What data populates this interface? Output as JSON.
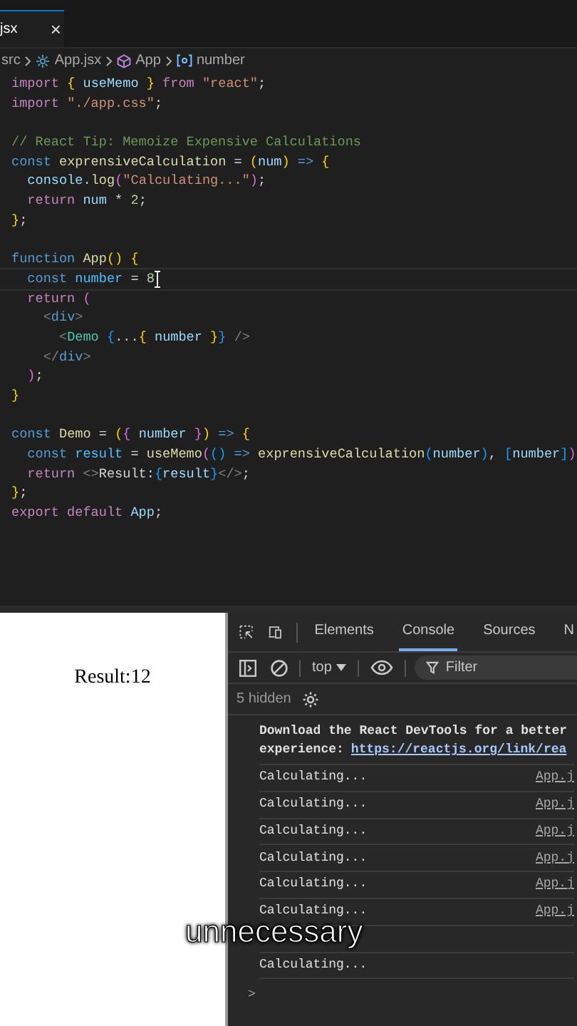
{
  "editor": {
    "tab": {
      "label": "jsx",
      "close": "×",
      "selected": true
    },
    "breadcrumb": [
      {
        "kind": "folder",
        "text": "src"
      },
      {
        "kind": "file",
        "text": "App.jsx"
      },
      {
        "kind": "component",
        "text": "App"
      },
      {
        "kind": "variable",
        "text": "number"
      }
    ],
    "lines": [
      {
        "kind": "code",
        "tokens": [
          {
            "kind": "kw",
            "text": "import "
          },
          {
            "kind": "b1",
            "text": "{"
          },
          {
            "kind": "var",
            "text": " useMemo "
          },
          {
            "kind": "b1",
            "text": "} "
          },
          {
            "kind": "kw",
            "text": "from "
          },
          {
            "kind": "str",
            "text": "\"react\""
          },
          {
            "kind": "p",
            "text": ";"
          }
        ]
      },
      {
        "kind": "code",
        "tokens": [
          {
            "kind": "kw",
            "text": "import "
          },
          {
            "kind": "str",
            "text": "\"./app.css\""
          },
          {
            "kind": "p",
            "text": ";"
          }
        ]
      },
      {
        "kind": "blank"
      },
      {
        "kind": "code",
        "tokens": [
          {
            "kind": "cmt",
            "text": "// React Tip: Memoize Expensive Calculations"
          }
        ]
      },
      {
        "kind": "code",
        "tokens": [
          {
            "kind": "decl",
            "text": "const "
          },
          {
            "kind": "fn",
            "text": "exprensiveCalculation"
          },
          {
            "kind": "p",
            "text": " = "
          },
          {
            "kind": "b1",
            "text": "("
          },
          {
            "kind": "var",
            "text": "num"
          },
          {
            "kind": "b1",
            "text": ") "
          },
          {
            "kind": "decl",
            "text": "=> "
          },
          {
            "kind": "b1",
            "text": "{"
          }
        ]
      },
      {
        "kind": "code",
        "tokens": [
          {
            "kind": "var",
            "text": "  console"
          },
          {
            "kind": "p",
            "text": "."
          },
          {
            "kind": "fn",
            "text": "log"
          },
          {
            "kind": "b2",
            "text": "("
          },
          {
            "kind": "str",
            "text": "\"Calculating...\""
          },
          {
            "kind": "b2",
            "text": ")"
          },
          {
            "kind": "p",
            "text": ";"
          }
        ]
      },
      {
        "kind": "code",
        "tokens": [
          {
            "kind": "kw",
            "text": "  return "
          },
          {
            "kind": "var",
            "text": "num"
          },
          {
            "kind": "p",
            "text": " * "
          },
          {
            "kind": "num",
            "text": "2"
          },
          {
            "kind": "p",
            "text": ";"
          }
        ]
      },
      {
        "kind": "code",
        "tokens": [
          {
            "kind": "b1",
            "text": "}"
          },
          {
            "kind": "p",
            "text": ";"
          }
        ]
      },
      {
        "kind": "blank"
      },
      {
        "kind": "code",
        "tokens": [
          {
            "kind": "decl",
            "text": "function "
          },
          {
            "kind": "fn",
            "text": "App"
          },
          {
            "kind": "b1",
            "text": "() {"
          }
        ]
      },
      {
        "kind": "code",
        "current": true,
        "tokens": [
          {
            "kind": "decl",
            "text": "  const "
          },
          {
            "kind": "cvar",
            "text": "number"
          },
          {
            "kind": "p",
            "text": " = "
          },
          {
            "kind": "num",
            "text": "8"
          }
        ]
      },
      {
        "kind": "code",
        "tokens": [
          {
            "kind": "kw",
            "text": "  return "
          },
          {
            "kind": "b2",
            "text": "("
          }
        ]
      },
      {
        "kind": "code",
        "tokens": [
          {
            "kind": "tagp",
            "text": "    <"
          },
          {
            "kind": "decl",
            "text": "div"
          },
          {
            "kind": "tagp",
            "text": ">"
          }
        ]
      },
      {
        "kind": "code",
        "tokens": [
          {
            "kind": "tagp",
            "text": "      <"
          },
          {
            "kind": "tag",
            "text": "Demo "
          },
          {
            "kind": "b3",
            "text": "{"
          },
          {
            "kind": "p",
            "text": "..."
          },
          {
            "kind": "b1",
            "text": "{"
          },
          {
            "kind": "var",
            "text": " number "
          },
          {
            "kind": "b1",
            "text": "}"
          },
          {
            "kind": "b3",
            "text": "} "
          },
          {
            "kind": "tagp",
            "text": "/>"
          }
        ]
      },
      {
        "kind": "code",
        "tokens": [
          {
            "kind": "tagp",
            "text": "    </"
          },
          {
            "kind": "decl",
            "text": "div"
          },
          {
            "kind": "tagp",
            "text": ">"
          }
        ]
      },
      {
        "kind": "code",
        "tokens": [
          {
            "kind": "b2",
            "text": "  )"
          },
          {
            "kind": "p",
            "text": ";"
          }
        ]
      },
      {
        "kind": "code",
        "tokens": [
          {
            "kind": "b1",
            "text": "}"
          }
        ]
      },
      {
        "kind": "blank"
      },
      {
        "kind": "code",
        "tokens": [
          {
            "kind": "decl",
            "text": "const "
          },
          {
            "kind": "fn",
            "text": "Demo"
          },
          {
            "kind": "p",
            "text": " = "
          },
          {
            "kind": "b1",
            "text": "("
          },
          {
            "kind": "b2",
            "text": "{"
          },
          {
            "kind": "var",
            "text": " number "
          },
          {
            "kind": "b2",
            "text": "}"
          },
          {
            "kind": "b1",
            "text": ") "
          },
          {
            "kind": "decl",
            "text": "=> "
          },
          {
            "kind": "b1",
            "text": "{"
          }
        ]
      },
      {
        "kind": "code",
        "tokens": [
          {
            "kind": "decl",
            "text": "  const "
          },
          {
            "kind": "cvar",
            "text": "result"
          },
          {
            "kind": "p",
            "text": " = "
          },
          {
            "kind": "fn",
            "text": "useMemo"
          },
          {
            "kind": "b2",
            "text": "("
          },
          {
            "kind": "b3",
            "text": "() "
          },
          {
            "kind": "decl",
            "text": "=> "
          },
          {
            "kind": "fn",
            "text": "exprensiveCalculation"
          },
          {
            "kind": "b3",
            "text": "("
          },
          {
            "kind": "var",
            "text": "number"
          },
          {
            "kind": "b3",
            "text": ")"
          },
          {
            "kind": "p",
            "text": ", "
          },
          {
            "kind": "b3",
            "text": "["
          },
          {
            "kind": "var",
            "text": "number"
          },
          {
            "kind": "b3",
            "text": "]"
          },
          {
            "kind": "b2",
            "text": ")"
          }
        ]
      },
      {
        "kind": "code",
        "tokens": [
          {
            "kind": "kw",
            "text": "  return "
          },
          {
            "kind": "tagp",
            "text": "<>"
          },
          {
            "kind": "p",
            "text": "Result:"
          },
          {
            "kind": "b3",
            "text": "{"
          },
          {
            "kind": "var",
            "text": "result"
          },
          {
            "kind": "b3",
            "text": "}"
          },
          {
            "kind": "tagp",
            "text": "</>"
          },
          {
            "kind": "p",
            "text": ";"
          }
        ]
      },
      {
        "kind": "code",
        "tokens": [
          {
            "kind": "b1",
            "text": "}"
          },
          {
            "kind": "p",
            "text": ";"
          }
        ]
      },
      {
        "kind": "code",
        "tokens": [
          {
            "kind": "kw",
            "text": "export default "
          },
          {
            "kind": "var",
            "text": "App"
          },
          {
            "kind": "p",
            "text": ";"
          }
        ]
      }
    ]
  },
  "preview": {
    "text": "Result:12"
  },
  "devtools": {
    "tabs": [
      {
        "label": "Elements",
        "selected": false
      },
      {
        "label": "Console",
        "selected": true
      },
      {
        "label": "Sources",
        "selected": false
      },
      {
        "label": "N",
        "selected": false
      }
    ],
    "context": "top",
    "filter": {
      "placeholder": "Filter"
    },
    "hidden": "5 hidden",
    "notice": {
      "text": "Download the React DevTools for a better",
      "link_label": "experience:",
      "link": "https://reactjs.org/link/rea"
    },
    "messages": [
      {
        "kind": "log",
        "text": "Calculating...",
        "source": "App.j"
      },
      {
        "kind": "log",
        "text": "Calculating...",
        "source": "App.j"
      },
      {
        "kind": "log",
        "text": "Calculating...",
        "source": "App.j"
      },
      {
        "kind": "log",
        "text": "Calculating...",
        "source": "App.j"
      },
      {
        "kind": "log",
        "text": "Calculating...",
        "source": "App.j"
      },
      {
        "kind": "log",
        "text": "Calculating...",
        "source": "App.j"
      },
      {
        "kind": "covered"
      },
      {
        "kind": "log",
        "text": "Calculating..."
      }
    ],
    "prompt": ">"
  },
  "caption": "unnecessary"
}
